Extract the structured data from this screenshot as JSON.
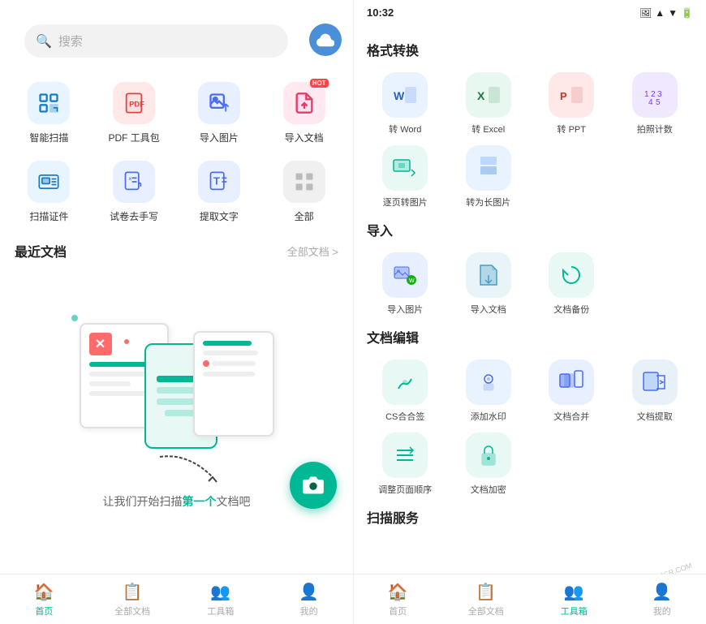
{
  "left": {
    "search_placeholder": "搜索",
    "cloud_label": "cloud",
    "grid_items": [
      {
        "id": "scan",
        "label": "智能扫描",
        "icon": "📷",
        "color": "icon-scan",
        "hot": false
      },
      {
        "id": "pdf",
        "label": "PDF 工具包",
        "icon": "📄",
        "color": "icon-pdf",
        "hot": false
      },
      {
        "id": "import_img",
        "label": "导入图片",
        "icon": "🖼",
        "color": "icon-import-img",
        "hot": false
      },
      {
        "id": "import_doc",
        "label": "导入文档",
        "icon": "📁",
        "color": "icon-import-doc",
        "hot": true
      },
      {
        "id": "id_card",
        "label": "扫描证件",
        "icon": "💳",
        "color": "icon-id-card",
        "hot": false
      },
      {
        "id": "exam",
        "label": "试卷去手写",
        "icon": "✏️",
        "color": "icon-exam",
        "hot": false
      },
      {
        "id": "extract",
        "label": "提取文字",
        "icon": "T",
        "color": "icon-extract",
        "hot": false
      },
      {
        "id": "all",
        "label": "全部",
        "icon": "⊞",
        "color": "icon-all",
        "hot": false
      }
    ],
    "recent_title": "最近文档",
    "recent_link": "全部文档 >",
    "empty_text_prefix": "让我们开始扫描",
    "empty_text_bold": "第一个",
    "empty_text_suffix": "文档吧",
    "bottom_nav": [
      {
        "id": "home",
        "label": "首页",
        "icon": "🏠",
        "active": true
      },
      {
        "id": "docs",
        "label": "全部文档",
        "icon": "📋",
        "active": false
      },
      {
        "id": "tools",
        "label": "工具箱",
        "icon": "👥",
        "active": false
      },
      {
        "id": "mine",
        "label": "我的",
        "icon": "👤",
        "active": false
      }
    ]
  },
  "right": {
    "status_time": "10:32",
    "sections": [
      {
        "id": "format",
        "title": "格式转换",
        "items": [
          {
            "id": "to_word",
            "label": "转 Word",
            "color": "t-word"
          },
          {
            "id": "to_excel",
            "label": "转 Excel",
            "color": "t-excel"
          },
          {
            "id": "to_ppt",
            "label": "转 PPT",
            "color": "t-ppt"
          },
          {
            "id": "count_photo",
            "label": "拍照计数",
            "color": "t-count"
          },
          {
            "id": "page_to_img",
            "label": "逐页转图片",
            "color": "t-page-img"
          },
          {
            "id": "to_long_img",
            "label": "转为长图片",
            "color": "t-long-img"
          }
        ]
      },
      {
        "id": "import",
        "title": "导入",
        "items": [
          {
            "id": "import_img2",
            "label": "导入图片",
            "color": "t-import-img2"
          },
          {
            "id": "import_doc2",
            "label": "导入文档",
            "color": "t-import-doc2"
          },
          {
            "id": "backup",
            "label": "文档备份",
            "color": "t-backup"
          }
        ]
      },
      {
        "id": "edit",
        "title": "文档编辑",
        "items": [
          {
            "id": "cs_sign",
            "label": "CS合合签",
            "color": "t-cs"
          },
          {
            "id": "watermark",
            "label": "添加水印",
            "color": "t-watermark"
          },
          {
            "id": "merge",
            "label": "文档合并",
            "color": "t-merge"
          },
          {
            "id": "extract2",
            "label": "文档提取",
            "color": "t-extract"
          },
          {
            "id": "reorder",
            "label": "调整页面顺序",
            "color": "t-reorder"
          },
          {
            "id": "encrypt",
            "label": "文档加密",
            "color": "t-encrypt"
          }
        ]
      },
      {
        "id": "scan_service",
        "title": "扫描服务",
        "items": []
      }
    ],
    "bottom_nav": [
      {
        "id": "home",
        "label": "首页",
        "icon": "🏠",
        "active": false
      },
      {
        "id": "docs",
        "label": "全部文档",
        "icon": "📋",
        "active": false
      },
      {
        "id": "tools",
        "label": "工具箱",
        "icon": "👥",
        "active": true
      },
      {
        "id": "mine",
        "label": "我的",
        "icon": "👤",
        "active": false
      }
    ]
  }
}
